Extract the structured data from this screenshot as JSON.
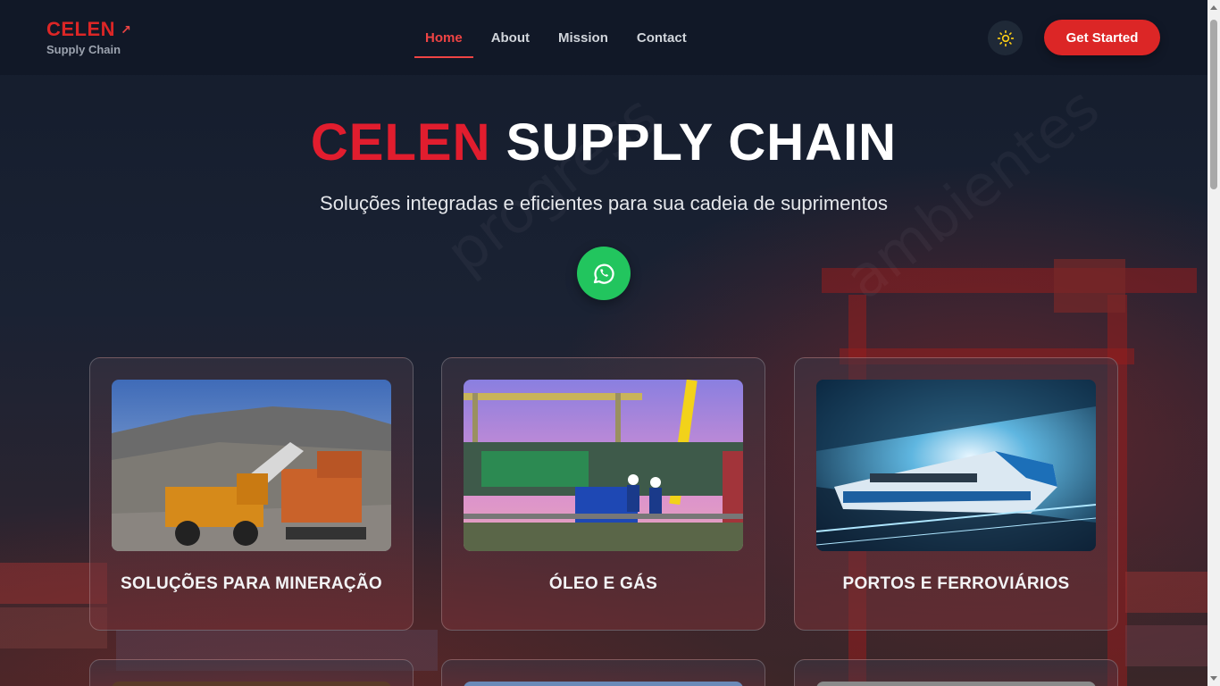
{
  "brand": {
    "name": "CELEN",
    "subtitle": "Supply Chain"
  },
  "nav": {
    "items": [
      {
        "label": "Home",
        "active": true
      },
      {
        "label": "About",
        "active": false
      },
      {
        "label": "Mission",
        "active": false
      },
      {
        "label": "Contact",
        "active": false
      }
    ],
    "theme_toggle_icon": "sun-icon",
    "cta_label": "Get Started"
  },
  "hero": {
    "title_accent": "CELEN",
    "title_rest": "SUPPLY CHAIN",
    "subtitle": "Soluções integradas e eficientes para sua cadeia de suprimentos",
    "whatsapp_icon": "whatsapp-icon"
  },
  "cards": [
    {
      "label": "SOLUÇÕES PARA MINERAÇÃO",
      "image": "mining-truck-excavator"
    },
    {
      "label": "ÓLEO E GÁS",
      "image": "oil-gas-rig-workers"
    },
    {
      "label": "PORTOS E FERROVIÁRIOS",
      "image": "high-speed-train"
    }
  ],
  "colors": {
    "accent": "#dc2626",
    "whatsapp": "#22c55e",
    "nav_bg": "#111827"
  }
}
